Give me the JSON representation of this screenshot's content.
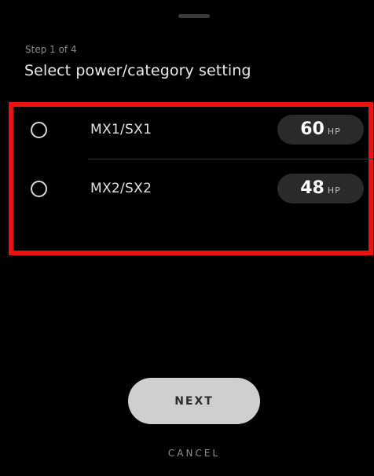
{
  "header": {
    "step_text": "Step 1 of 4",
    "title": "Select power/category setting"
  },
  "options": [
    {
      "label": "MX1/SX1",
      "hp_value": "60",
      "hp_unit": "HP",
      "selected": false
    },
    {
      "label": "MX2/SX2",
      "hp_value": "48",
      "hp_unit": "HP",
      "selected": false
    }
  ],
  "actions": {
    "next_label": "NEXT",
    "cancel_label": "CANCEL"
  },
  "colors": {
    "background": "#000000",
    "highlight": "#ee1111",
    "pill": "#2a2a2a",
    "next_button": "#cfcfcf"
  }
}
